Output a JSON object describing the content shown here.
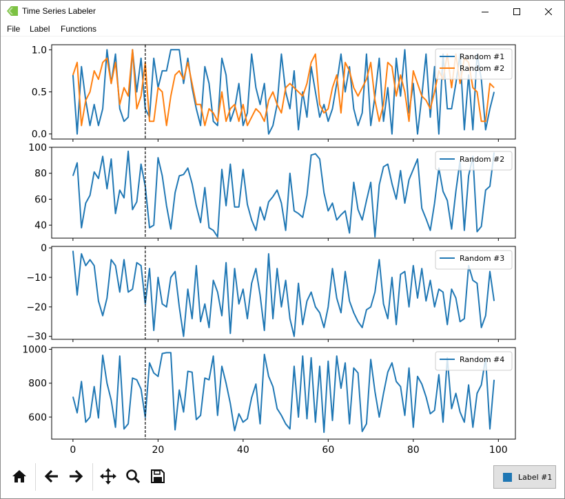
{
  "window": {
    "title": "Time Series Labeler",
    "icon": "tag-icon",
    "icon_color": "#7cc242"
  },
  "menu": {
    "items": [
      {
        "label": "File",
        "name": "menu-file"
      },
      {
        "label": "Label",
        "name": "menu-label"
      },
      {
        "label": "Functions",
        "name": "menu-functions"
      }
    ]
  },
  "chart_data": [
    {
      "type": "line",
      "xlim": [
        -5,
        104
      ],
      "ylim": [
        -0.06,
        1.06
      ],
      "yticks": [
        0.0,
        0.5,
        1.0
      ],
      "ytick_labels": [
        "0.0",
        "0.5",
        "1.0"
      ],
      "legend_placement": "top-right",
      "marker_x": 17,
      "series": [
        {
          "name": "Random #1",
          "color": "#1f77b4",
          "values": [
            0.7,
            0.0,
            0.8,
            0.4,
            0.1,
            0.35,
            0.1,
            0.3,
            1.0,
            0.6,
            0.95,
            0.3,
            0.15,
            0.2,
            1.0,
            0.5,
            0.9,
            0.3,
            0.2,
            0.9,
            0.55,
            0.75,
            0.75,
            1.0,
            1.0,
            1.0,
            0.6,
            0.9,
            0.55,
            0.3,
            0.1,
            0.8,
            0.6,
            0.15,
            0.1,
            0.9,
            0.7,
            0.15,
            0.3,
            0.6,
            0.1,
            0.25,
            0.95,
            0.55,
            0.35,
            0.6,
            0.0,
            0.1,
            0.35,
            0.95,
            0.5,
            0.3,
            0.75,
            0.05,
            0.5,
            0.2,
            0.8,
            0.5,
            0.2,
            0.35,
            0.15,
            0.3,
            0.6,
            0.95,
            0.5,
            0.8,
            0.3,
            0.1,
            0.25,
            0.95,
            0.1,
            0.45,
            0.9,
            0.15,
            0.55,
            0.0,
            0.9,
            0.45,
            1.0,
            0.25,
            0.6,
            0.0,
            0.45,
            0.95,
            0.2,
            0.8,
            0.0,
            0.95,
            0.3,
            0.3,
            0.6,
            0.95,
            0.05,
            0.7,
            0.05,
            0.95,
            0.65,
            0.05,
            0.3,
            0.5
          ]
        },
        {
          "name": "Random #2",
          "color": "#ff7f0e",
          "values": [
            0.7,
            0.85,
            0.1,
            0.4,
            0.5,
            0.75,
            0.65,
            0.85,
            0.9,
            0.6,
            0.85,
            0.35,
            0.55,
            0.45,
            1.0,
            0.3,
            0.45,
            0.85,
            0.15,
            0.15,
            0.55,
            0.5,
            0.1,
            0.45,
            0.7,
            0.75,
            0.65,
            0.85,
            0.6,
            0.35,
            0.35,
            0.1,
            0.3,
            0.25,
            0.15,
            0.5,
            0.15,
            0.3,
            0.35,
            0.15,
            0.35,
            0.1,
            0.2,
            0.3,
            0.25,
            0.15,
            0.4,
            0.5,
            0.35,
            0.25,
            0.55,
            0.6,
            0.55,
            0.5,
            0.45,
            0.6,
            0.85,
            0.95,
            0.35,
            0.25,
            0.3,
            0.55,
            0.7,
            0.25,
            0.85,
            0.75,
            0.55,
            0.45,
            0.55,
            0.65,
            0.85,
            0.4,
            0.15,
            0.35,
            0.85,
            0.8,
            0.45,
            0.7,
            0.5,
            0.15,
            0.75,
            0.6,
            0.45,
            0.4,
            0.3,
            0.5,
            0.75,
            0.65,
            0.95,
            0.55,
            0.95,
            0.6,
            0.9,
            0.85,
            0.55,
            0.5,
            0.15,
            0.15,
            0.6,
            0.55
          ]
        }
      ]
    },
    {
      "type": "line",
      "xlim": [
        -5,
        104
      ],
      "ylim": [
        30,
        100
      ],
      "yticks": [
        40,
        60,
        80,
        100
      ],
      "ytick_labels": [
        "40",
        "60",
        "80",
        "100"
      ],
      "legend_placement": "top-right",
      "marker_x": 17,
      "series": [
        {
          "name": "Random #2",
          "color": "#1f77b4",
          "values": [
            78,
            88,
            38,
            57,
            63,
            81,
            76,
            93,
            68,
            91,
            49,
            67,
            61,
            97,
            52,
            58,
            87,
            70,
            38,
            40,
            92,
            78,
            55,
            37,
            65,
            78,
            79,
            84,
            72,
            55,
            42,
            69,
            38,
            36,
            31,
            83,
            55,
            87,
            54,
            54,
            83,
            56,
            44,
            36,
            54,
            44,
            58,
            62,
            67,
            57,
            36,
            80,
            51,
            49,
            46,
            63,
            94,
            95,
            91,
            65,
            51,
            57,
            44,
            48,
            51,
            34,
            73,
            52,
            44,
            59,
            73,
            31,
            71,
            85,
            87,
            72,
            60,
            82,
            57,
            75,
            83,
            91,
            53,
            45,
            36,
            57,
            84,
            66,
            59,
            37,
            66,
            90,
            36,
            78,
            93,
            35,
            39,
            67,
            70,
            96
          ]
        }
      ]
    },
    {
      "type": "line",
      "xlim": [
        -5,
        104
      ],
      "ylim": [
        -31,
        0.5
      ],
      "yticks": [
        -30,
        -20,
        -10,
        0
      ],
      "ytick_labels": [
        "−30",
        "−20",
        "−10",
        "0"
      ],
      "legend_placement": "top-right",
      "marker_x": 17,
      "series": [
        {
          "name": "Random #3",
          "color": "#1f77b4",
          "values": [
            -1,
            -16,
            -2,
            -6,
            -4,
            -6,
            -18,
            -23,
            -17,
            -4,
            -6,
            -15,
            -4,
            -15,
            -14,
            -5,
            -6,
            -19,
            -7,
            -28,
            -10,
            -19,
            -20,
            -10,
            -8,
            -20,
            -30,
            -14,
            -24,
            -6,
            -25,
            -19,
            -27,
            -11,
            -15,
            -23,
            -5,
            -29,
            -7,
            -19,
            -14,
            -24,
            -12,
            -7,
            -16,
            -28,
            -2,
            -24,
            -7,
            -20,
            -11,
            -24,
            -30,
            -12,
            -26,
            -18,
            -15,
            -20,
            -22,
            -27,
            -20,
            -7,
            -17,
            -22,
            -8,
            -18,
            -22,
            -25,
            -27,
            -21,
            -20,
            -15,
            -4,
            -19,
            -24,
            -10,
            -26,
            -9,
            -8,
            -20,
            -6,
            -17,
            -7,
            -18,
            -11,
            -20,
            -14,
            -15,
            -26,
            -14,
            -17,
            -25,
            -24,
            -6,
            -11,
            -12,
            -27,
            -23,
            -8,
            -18
          ]
        }
      ]
    },
    {
      "type": "line",
      "xlim": [
        -5,
        104
      ],
      "ylim": [
        470,
        1010
      ],
      "yticks": [
        600,
        800,
        1000
      ],
      "ytick_labels": [
        "600",
        "800",
        "1000"
      ],
      "legend_placement": "top-right",
      "marker_x": 17,
      "series": [
        {
          "name": "Random #4",
          "color": "#1f77b4",
          "values": [
            720,
            625,
            810,
            570,
            600,
            780,
            595,
            965,
            800,
            700,
            540,
            960,
            530,
            560,
            830,
            820,
            765,
            600,
            920,
            860,
            840,
            975,
            980,
            980,
            525,
            760,
            630,
            870,
            865,
            585,
            610,
            830,
            820,
            960,
            610,
            900,
            800,
            680,
            520,
            620,
            570,
            590,
            715,
            795,
            560,
            970,
            840,
            780,
            650,
            610,
            560,
            530,
            900,
            600,
            960,
            590,
            950,
            570,
            900,
            510,
            930,
            580,
            960,
            770,
            920,
            560,
            890,
            860,
            515,
            560,
            940,
            750,
            600,
            740,
            865,
            920,
            810,
            780,
            610,
            890,
            540,
            840,
            795,
            720,
            620,
            640,
            850,
            570,
            950,
            650,
            740,
            630,
            570,
            790,
            540,
            740,
            790,
            950,
            530,
            820
          ]
        }
      ]
    }
  ],
  "xaxis": {
    "ticks": [
      0,
      20,
      40,
      60,
      80,
      100
    ],
    "tick_labels": [
      "0",
      "20",
      "40",
      "60",
      "80",
      "100"
    ]
  },
  "toolbar": {
    "buttons": [
      {
        "name": "home-icon",
        "glyph": "home"
      },
      {
        "name": "back-arrow-icon",
        "glyph": "back"
      },
      {
        "name": "forward-arrow-icon",
        "glyph": "forward"
      },
      {
        "name": "pan-icon",
        "glyph": "move"
      },
      {
        "name": "zoom-icon",
        "glyph": "search"
      },
      {
        "name": "save-icon",
        "glyph": "floppy"
      }
    ]
  },
  "label_button": {
    "text": "Label #1",
    "swatch_color": "#1f77b4"
  }
}
